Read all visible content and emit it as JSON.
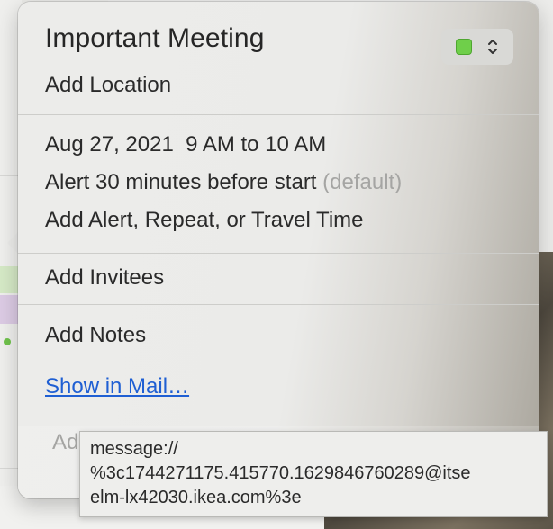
{
  "event": {
    "title": "Important Meeting",
    "location_placeholder": "Add Location",
    "date": "Aug 27, 2021",
    "time": "9 AM to 10 AM",
    "alert_text": "Alert 30 minutes before start",
    "alert_default": "(default)",
    "alert_repeat_placeholder": "Add Alert, Repeat, or Travel Time",
    "invitees_placeholder": "Add Invitees",
    "notes_placeholder": "Add Notes",
    "show_in_mail_link": "Show in Mail…",
    "partial_add_label": "Ad",
    "calendar_color": "#6fcf4a"
  },
  "tooltip": {
    "lines": [
      "message://",
      "%3c1744271175.415770.1629846760289@itse",
      "elm-lx42030.ikea.com%3e"
    ]
  },
  "icons": {
    "color_picker_chevron": "chevron-up-down-icon"
  }
}
